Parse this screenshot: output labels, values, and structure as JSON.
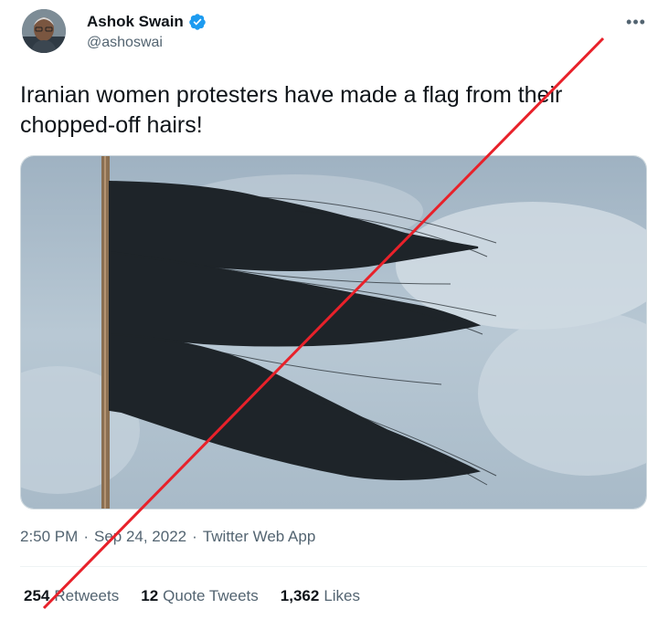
{
  "author": {
    "display_name": "Ashok Swain",
    "handle": "@ashoswai",
    "verified_icon": "verified-badge-icon"
  },
  "tweet": {
    "text": "Iranian women protesters have made a flag from their chopped-off hairs!",
    "time": "2:50 PM",
    "separator1": "·",
    "date": "Sep 24, 2022",
    "separator2": "·",
    "source": "Twitter Web App"
  },
  "stats": [
    {
      "count": "254",
      "label": "Retweets"
    },
    {
      "count": "12",
      "label": "Quote Tweets"
    },
    {
      "count": "1,362",
      "label": "Likes"
    }
  ],
  "colors": {
    "verified": "#1d9bf0",
    "strike": "#e8212a",
    "secondary_text": "#536471"
  }
}
